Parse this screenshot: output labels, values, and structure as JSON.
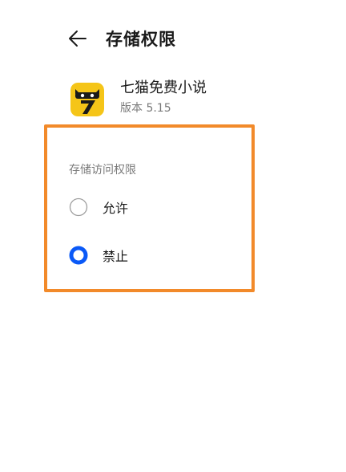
{
  "header": {
    "title": "存储权限"
  },
  "app": {
    "name": "七猫免费小说",
    "version": "版本 5.15",
    "icon": "seven-cat-app-icon"
  },
  "permission": {
    "section_label": "存储访问权限",
    "options": [
      {
        "label": "允许",
        "selected": false
      },
      {
        "label": "禁止",
        "selected": true
      }
    ]
  },
  "colors": {
    "accent": "#0a59f7",
    "highlight_border": "#f28a2a",
    "app_icon_bg": "#f5c518"
  }
}
